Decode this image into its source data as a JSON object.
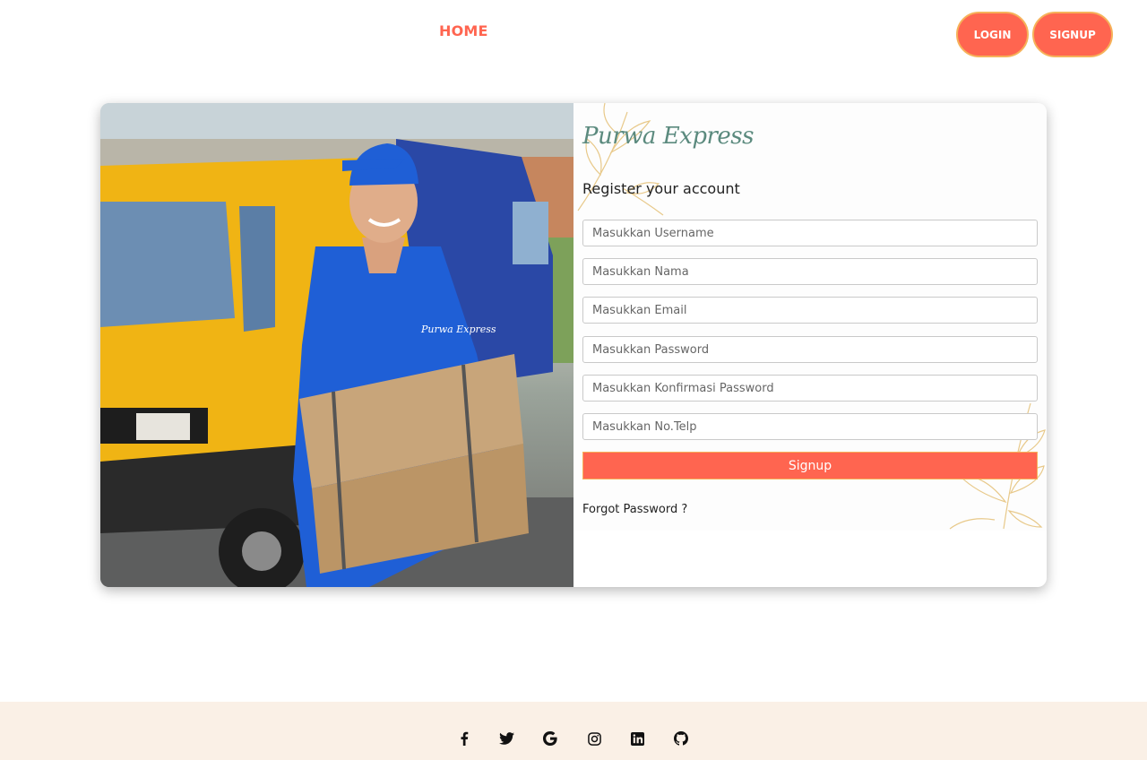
{
  "nav": {
    "home_label": "HOME",
    "login_label": "LOGIN",
    "signup_label": "SIGNUP"
  },
  "form": {
    "brand": "Purwa Express",
    "heading": "Register your account",
    "fields": [
      {
        "placeholder": "Masukkan Username",
        "value": ""
      },
      {
        "placeholder": "Masukkan Nama",
        "value": ""
      },
      {
        "placeholder": "Masukkan Email",
        "value": ""
      },
      {
        "placeholder": "Masukkan Password",
        "value": ""
      },
      {
        "placeholder": "Masukkan Konfirmasi Password",
        "value": ""
      },
      {
        "placeholder": "Masukkan No.Telp",
        "value": ""
      }
    ],
    "submit_label": "Signup",
    "forgot_label": "Forgot Password ?"
  },
  "hero": {
    "shirt_logo": "Purwa Express"
  },
  "footer": {
    "social_icons": [
      "facebook-icon",
      "twitter-icon",
      "google-icon",
      "instagram-icon",
      "linkedin-icon",
      "github-icon"
    ]
  },
  "colors": {
    "accent": "#ff6550",
    "accent_border": "#f6b25a",
    "footer_bg": "#faf0e6",
    "brand_text": "#5b8a7e"
  }
}
